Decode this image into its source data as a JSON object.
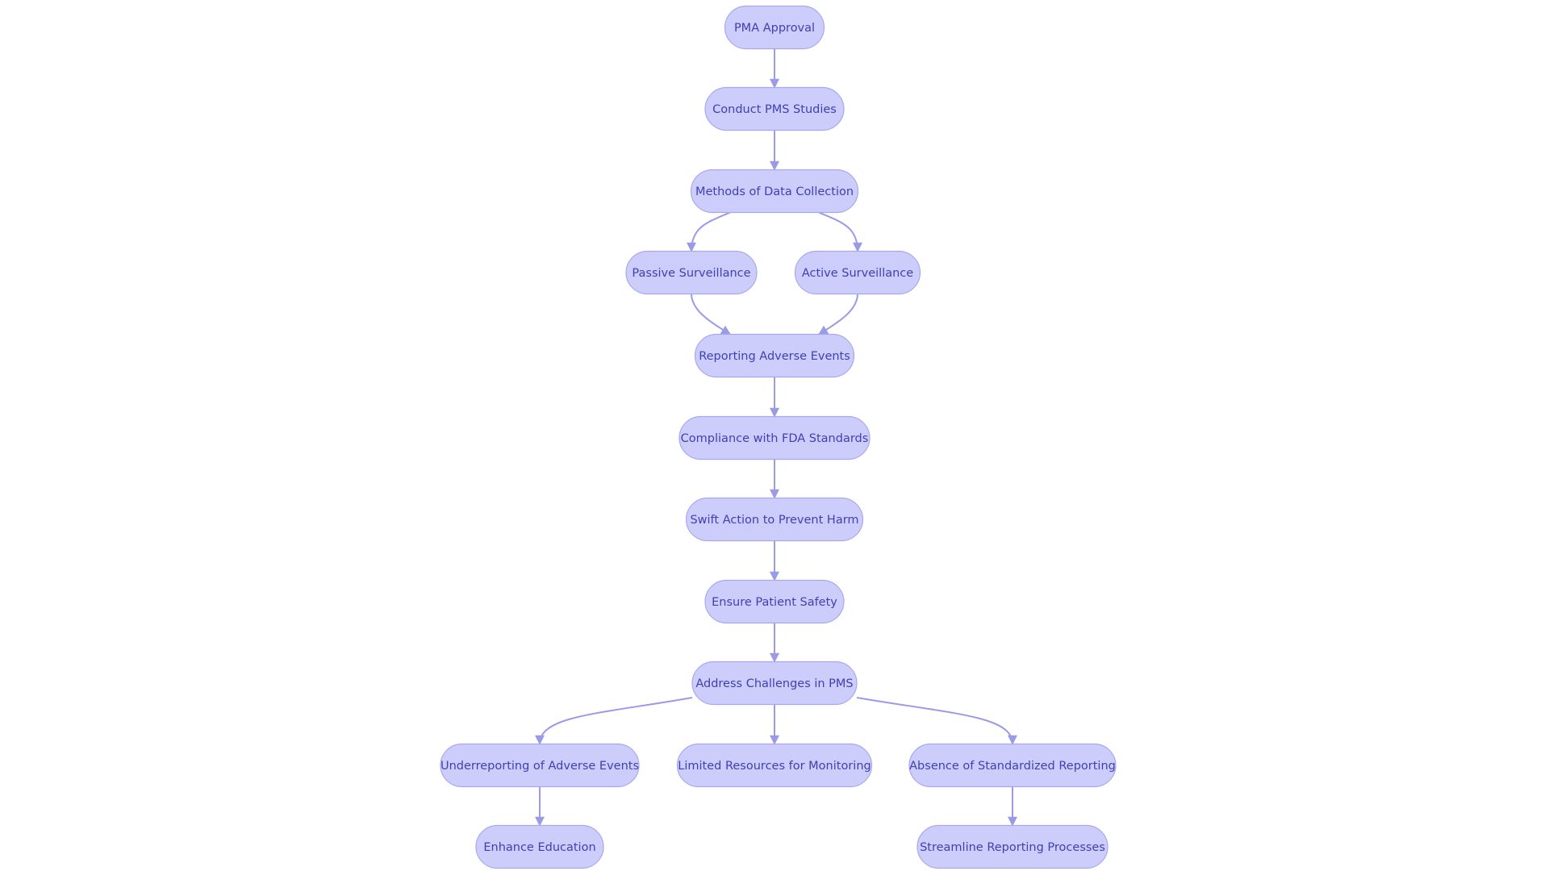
{
  "diagram": {
    "type": "flowchart",
    "direction": "top-down",
    "colors": {
      "node_fill": "#cdcdfc",
      "node_stroke": "#a8a8f0",
      "text": "#3f3fb5",
      "edge": "#9a9ae6"
    },
    "nodes": [
      {
        "id": "pma",
        "label": "PMA Approval"
      },
      {
        "id": "pms",
        "label": "Conduct PMS Studies"
      },
      {
        "id": "methods",
        "label": "Methods of Data Collection"
      },
      {
        "id": "passive",
        "label": "Passive Surveillance"
      },
      {
        "id": "active",
        "label": "Active Surveillance"
      },
      {
        "id": "reporting",
        "label": "Reporting Adverse Events"
      },
      {
        "id": "compliance",
        "label": "Compliance with FDA Standards"
      },
      {
        "id": "swift",
        "label": "Swift Action to Prevent Harm"
      },
      {
        "id": "ensure",
        "label": "Ensure Patient Safety"
      },
      {
        "id": "address",
        "label": "Address Challenges in PMS"
      },
      {
        "id": "under",
        "label": "Underreporting of Adverse Events"
      },
      {
        "id": "limited",
        "label": "Limited Resources for Monitoring"
      },
      {
        "id": "absence",
        "label": "Absence of Standardized Reporting"
      },
      {
        "id": "educ",
        "label": "Enhance Education"
      },
      {
        "id": "stream",
        "label": "Streamline Reporting Processes"
      }
    ],
    "edges": [
      [
        "pma",
        "pms"
      ],
      [
        "pms",
        "methods"
      ],
      [
        "methods",
        "passive"
      ],
      [
        "methods",
        "active"
      ],
      [
        "passive",
        "reporting"
      ],
      [
        "active",
        "reporting"
      ],
      [
        "reporting",
        "compliance"
      ],
      [
        "compliance",
        "swift"
      ],
      [
        "swift",
        "ensure"
      ],
      [
        "ensure",
        "address"
      ],
      [
        "address",
        "under"
      ],
      [
        "address",
        "limited"
      ],
      [
        "address",
        "absence"
      ],
      [
        "under",
        "educ"
      ],
      [
        "absence",
        "stream"
      ]
    ]
  }
}
